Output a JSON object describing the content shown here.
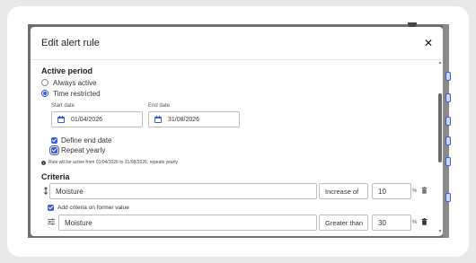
{
  "modal": {
    "title": "Edit alert rule",
    "close_symbol": "✕"
  },
  "active_period": {
    "heading": "Active period",
    "options": [
      {
        "label": "Always active",
        "checked": false
      },
      {
        "label": "Time restricted",
        "checked": true
      }
    ],
    "start_date_label": "Start date",
    "start_date_value": "01/04/2026",
    "end_date_label": "End date",
    "end_date_value": "31/08/2026",
    "define_end_date_label": "Define end date",
    "repeat_yearly_label": "Repeat yearly",
    "info_text": "Rule will be active from 01/04/2026 to 31/08/2026, repeats yearly"
  },
  "criteria": {
    "heading": "Criteria",
    "row1": {
      "parameter": "Moisture",
      "operator": "Increase of",
      "value": "10",
      "unit": "%"
    },
    "add_former_value_label": "Add criteria on former value",
    "row2": {
      "parameter": "Moisture",
      "operator": "Greater than",
      "value": "30",
      "unit": "%"
    }
  },
  "icons": {
    "calendar": "calendar-icon",
    "trash": "trash-icon",
    "drag": "drag-handle-icon",
    "filter": "sliders-icon",
    "info": "info-icon",
    "close": "close-icon"
  },
  "colors": {
    "accent": "#3b5bdb",
    "backdrop": "#6f6f6f"
  }
}
